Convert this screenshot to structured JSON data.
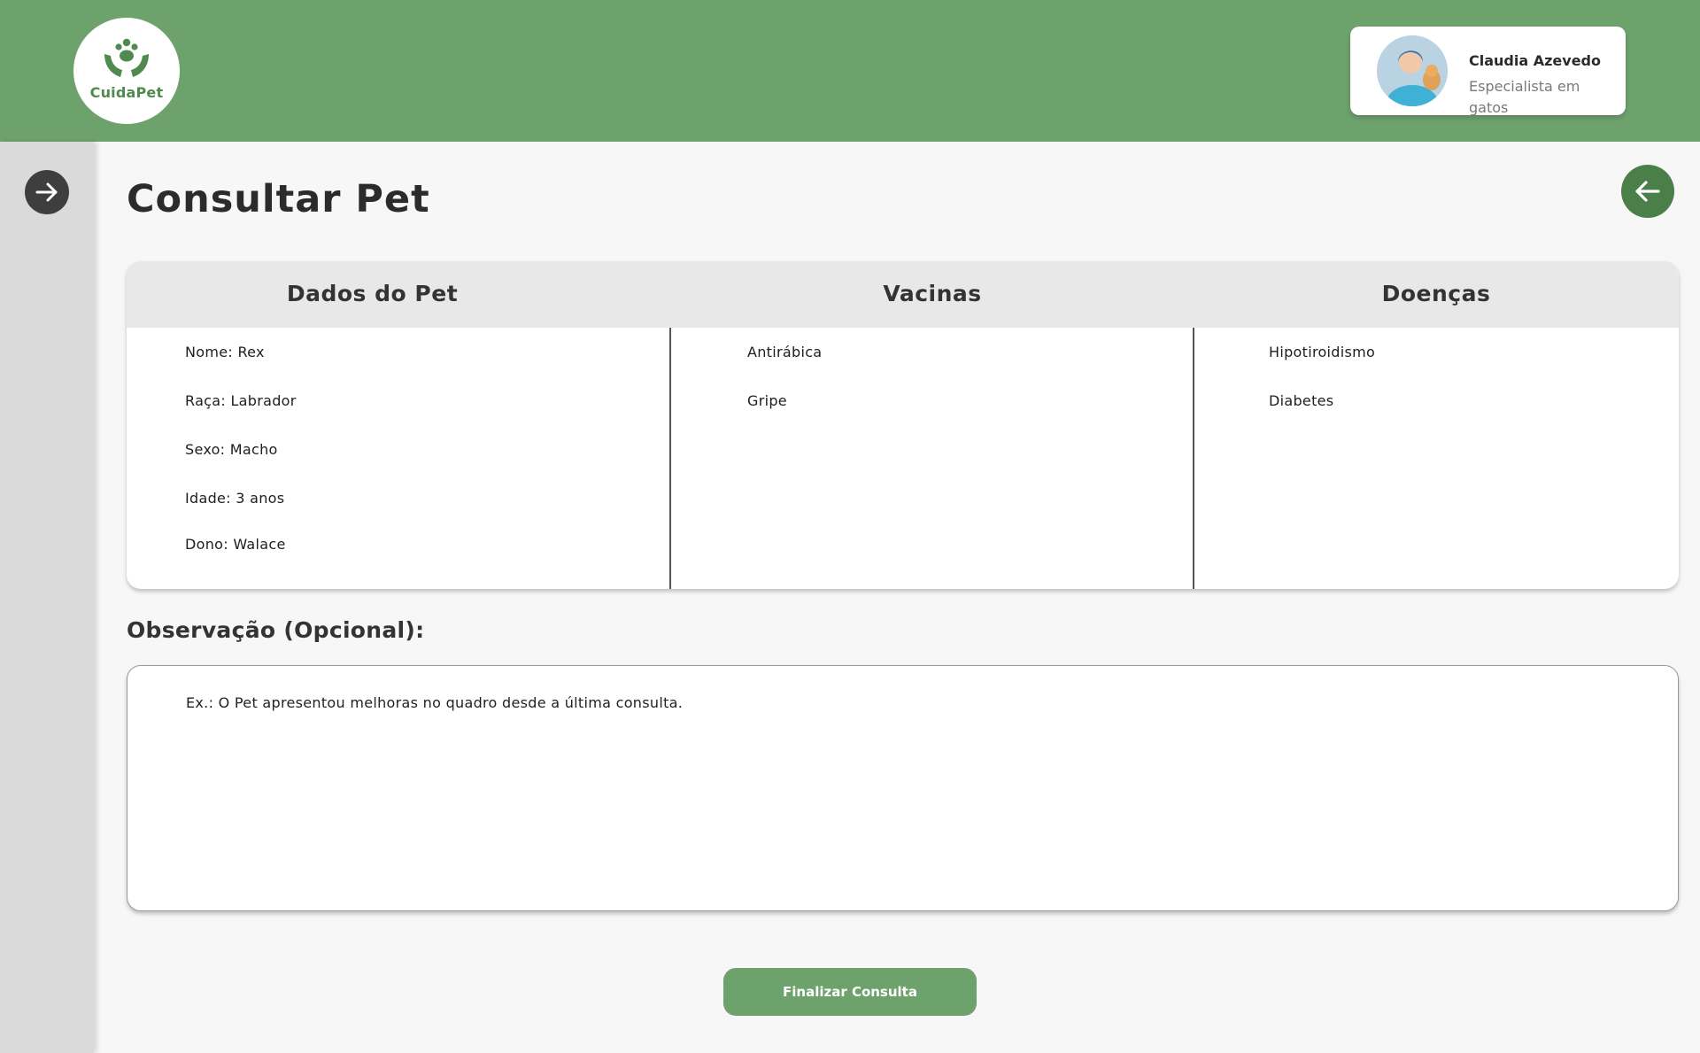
{
  "header": {
    "logo_text": "CuidaPet",
    "profile": {
      "name": "Claudia Azevedo",
      "role": "Especialista em gatos"
    }
  },
  "page": {
    "title": "Consultar Pet"
  },
  "table": {
    "columns": [
      "Dados do Pet",
      "Vacinas",
      "Doenças"
    ],
    "pet_data": [
      "Nome: Rex",
      "Raça: Labrador",
      "Sexo: Macho",
      "Idade: 3 anos",
      "Dono: Walace"
    ],
    "vaccines": [
      "Antirábica",
      "Gripe"
    ],
    "diseases": [
      "Hipotiroidismo",
      "Diabetes"
    ]
  },
  "observation": {
    "label": "Observação (Opcional):",
    "placeholder": "Ex.: O Pet apresentou melhoras no quadro desde a última consulta.",
    "value": ""
  },
  "actions": {
    "finish_label": "Finalizar Consulta"
  },
  "icons": {
    "logo": "paw-hands-icon",
    "sidebar_toggle": "arrow-right-icon",
    "back": "arrow-left-icon"
  },
  "colors": {
    "header_green": "#6ea26d",
    "back_button_green": "#4a7f49",
    "sidebar_gray": "#dadada",
    "toggle_dark": "#3e3e3e"
  }
}
